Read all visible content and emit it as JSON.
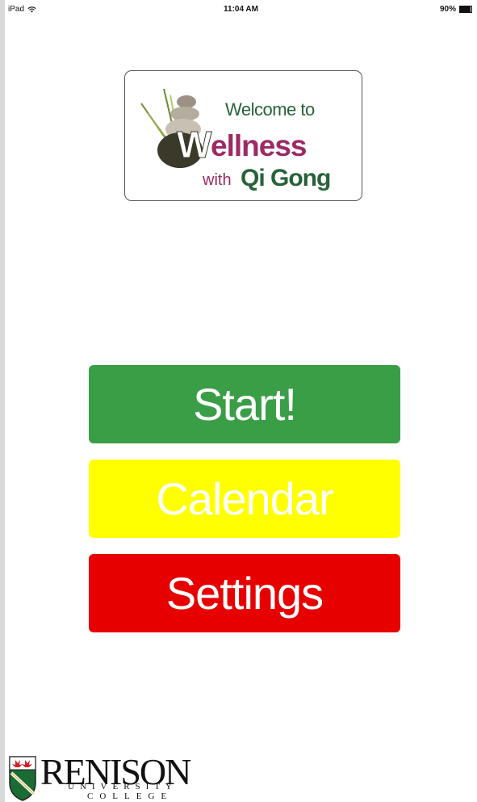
{
  "status_bar": {
    "device": "iPad",
    "time": "11:04 AM",
    "battery": "90%",
    "battery_level": 0.9
  },
  "logo": {
    "line1": "Welcome to",
    "big_letter": "W",
    "big_rest": "ellness",
    "line3_prefix": "with",
    "line3_main": "Qi Gong"
  },
  "buttons": {
    "start": {
      "label": "Start!",
      "color": "#3a9e47"
    },
    "calendar": {
      "label": "Calendar",
      "color": "#ffff00"
    },
    "settings": {
      "label": "Settings",
      "color": "#e60000"
    }
  },
  "footer": {
    "name": "RENISON",
    "sub1": "UNIVERSITY",
    "sub2": "COLLEGE"
  }
}
